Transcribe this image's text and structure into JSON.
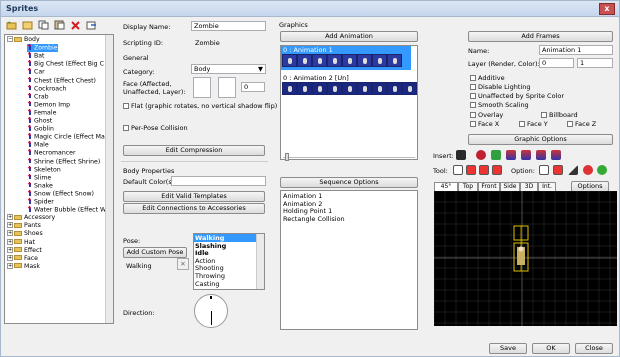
{
  "window": {
    "title": "Sprites",
    "close_glyph": "x"
  },
  "toolbar": {
    "icons": [
      "new-folder-icon",
      "open-folder-icon",
      "copy-icon",
      "paste-icon",
      "delete-icon",
      "export-icon"
    ]
  },
  "tree": {
    "items": [
      {
        "label": "Body",
        "type": "folder",
        "level": 0,
        "expanded": true
      },
      {
        "label": "Zombie",
        "type": "sprite",
        "level": 1,
        "selected": true
      },
      {
        "label": "Bat",
        "type": "sprite",
        "level": 1
      },
      {
        "label": "Big Chest (Effect Big C",
        "type": "sprite",
        "level": 1
      },
      {
        "label": "Car",
        "type": "sprite",
        "level": 1
      },
      {
        "label": "Chest (Effect Chest)",
        "type": "sprite",
        "level": 1
      },
      {
        "label": "Cockroach",
        "type": "sprite",
        "level": 1
      },
      {
        "label": "Crab",
        "type": "sprite",
        "level": 1
      },
      {
        "label": "Demon Imp",
        "type": "sprite",
        "level": 1
      },
      {
        "label": "Female",
        "type": "sprite",
        "level": 1
      },
      {
        "label": "Ghost",
        "type": "sprite",
        "level": 1
      },
      {
        "label": "Goblin",
        "type": "sprite",
        "level": 1
      },
      {
        "label": "Magic Circle (Effect Ma",
        "type": "sprite",
        "level": 1
      },
      {
        "label": "Male",
        "type": "sprite",
        "level": 1
      },
      {
        "label": "Necromancer",
        "type": "sprite",
        "level": 1
      },
      {
        "label": "Shrine (Effect Shrine)",
        "type": "sprite",
        "level": 1
      },
      {
        "label": "Skeleton",
        "type": "sprite",
        "level": 1
      },
      {
        "label": "Slime",
        "type": "sprite",
        "level": 1
      },
      {
        "label": "Snake",
        "type": "sprite",
        "level": 1
      },
      {
        "label": "Snow (Effect Snow)",
        "type": "sprite",
        "level": 1
      },
      {
        "label": "Spider",
        "type": "sprite",
        "level": 1
      },
      {
        "label": "Water Bubble (Effect W",
        "type": "sprite",
        "level": 1
      },
      {
        "label": "Accessory",
        "type": "folder",
        "level": 0
      },
      {
        "label": "Pants",
        "type": "folder",
        "level": 0
      },
      {
        "label": "Shoes",
        "type": "folder",
        "level": 0
      },
      {
        "label": "Hat",
        "type": "folder",
        "level": 0
      },
      {
        "label": "Effect",
        "type": "folder",
        "level": 0
      },
      {
        "label": "Face",
        "type": "folder",
        "level": 0
      },
      {
        "label": "Mask",
        "type": "folder",
        "level": 0
      }
    ]
  },
  "props": {
    "display_name_label": "Display Name:",
    "display_name_value": "Zombie",
    "scripting_id_label": "Scripting ID:",
    "scripting_id_value": "Zombie",
    "general_label": "General",
    "category_label": "Category:",
    "category_value": "Body",
    "face_label_1": "Face (Affected,",
    "face_label_2": "Unaffected, Layer):",
    "face_layer_value": "0",
    "flat_label": "Flat (graphic rotates, no vertical shadow flip)",
    "per_pose_label": "Per-Pose Collision",
    "edit_compression": "Edit Compression",
    "body_properties_label": "Body Properties",
    "default_colors_label": "Default Color(s):",
    "edit_valid_templates": "Edit Valid Templates",
    "edit_connections": "Edit Connections to Accessories",
    "pose_label": "Pose:",
    "add_custom_pose": "Add Custom Pose",
    "pose_value": "Walking",
    "direction_label": "Direction:",
    "poses": [
      {
        "label": "Walking",
        "bold": true,
        "selected": true
      },
      {
        "label": "Slashing",
        "bold": true
      },
      {
        "label": "Idle",
        "bold": true
      },
      {
        "label": "Action"
      },
      {
        "label": "Shooting"
      },
      {
        "label": "Throwing"
      },
      {
        "label": "Casting"
      }
    ]
  },
  "graphics": {
    "label": "Graphics",
    "add_animation": "Add Animation",
    "anim1": "0 : Animation 1",
    "anim2": "0 : Animation 2 [Un]",
    "sequence_options": "Sequence Options",
    "sequences": [
      "Animation 1",
      "Animation 2",
      "Holding Point 1",
      "Rectangle Collision"
    ]
  },
  "frames": {
    "add_frames": "Add Frames",
    "name_label": "Name:",
    "name_value": "Animation 1",
    "layer_label": "Layer (Render, Color):",
    "layer_render": "0",
    "layer_color": "1",
    "checks": [
      "Additive",
      "Disable Lighting",
      "Unaffected by Sprite Color",
      "Smooth Scaling"
    ],
    "overlay": "Overlay",
    "billboard": "Billboard",
    "face_x": "Face X",
    "face_y": "Face Y",
    "face_z": "Face Z",
    "graphic_options": "Graphic Options",
    "insert_label": "Insert:",
    "tool_label": "Tool:",
    "option_label": "Option:",
    "options_btn": "Options",
    "view_tabs": [
      "45°",
      "Top",
      "Front",
      "Side",
      "3D",
      "Int."
    ]
  },
  "footer": {
    "save": "Save",
    "ok": "OK",
    "close": "Close"
  }
}
